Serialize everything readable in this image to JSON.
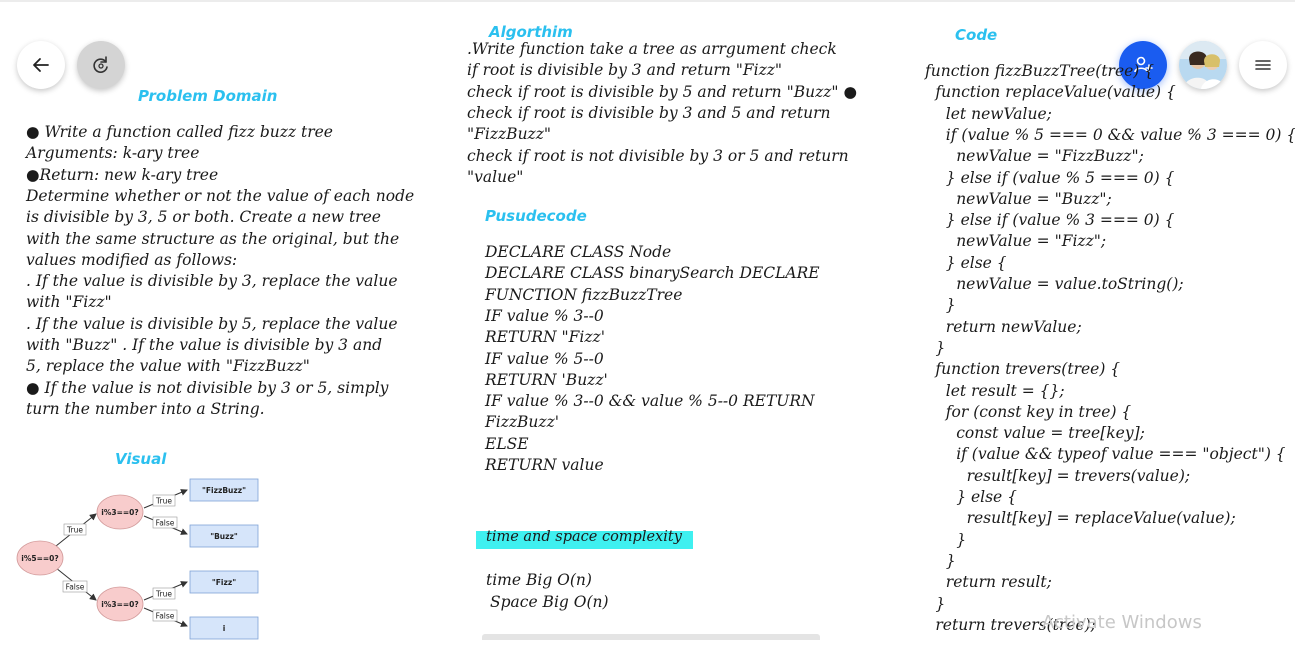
{
  "toolbar": {
    "back_icon": "arrow-left-icon",
    "redo_icon": "rotate-redo-icon",
    "share_icon": "add-user-icon",
    "menu_icon": "hamburger-menu-icon",
    "accent_color": "#1a5cf0"
  },
  "problem_domain": {
    "heading": "Problem Domain",
    "lines": [
      "● Write a function called fizz buzz tree",
      "Arguments: k-ary tree",
      "●Return: new k-ary tree",
      "Determine whether or not the value of each node",
      "is divisible by 3, 5 or both. Create a new tree",
      "with the same structure as the original, but the",
      "values modified as follows:",
      ". If the value is divisible by 3, replace the value",
      "with \"Fizz\"",
      ". If the value is divisible by 5, replace the value",
      "with \"Buzz\" . If the value is divisible by 3 and",
      "5, replace the value with \"FizzBuzz\"",
      "● If the value is not divisible by 3 or 5, simply",
      "turn the number into a String."
    ]
  },
  "visual": {
    "heading": "Visual",
    "nodes": {
      "root": "i%5==0?",
      "upper": "i%3==0?",
      "lower": "i%3==0?"
    },
    "edge_labels": {
      "root_true": "True",
      "root_false": "False",
      "upper_true": "True",
      "upper_false": "False",
      "lower_true": "True",
      "lower_false": "False"
    },
    "leaves": [
      "\"FizzBuzz\"",
      "\"Buzz\"",
      "\"Fizz\"",
      "i"
    ]
  },
  "algorithm": {
    "heading": "Algorthim",
    "lines": [
      ".Write function take a tree as arrgument check",
      "if root is divisible by 3 and return \"Fizz\"",
      "check if root is divisible by 5 and return \"Buzz\" ●",
      "check if root is divisible by 3 and 5 and return",
      "\"FizzBuzz\"",
      "check if root is not divisible by 3 or 5 and return",
      "\"value\""
    ]
  },
  "pseudocode": {
    "heading": "Pusudecode",
    "lines": [
      "DECLARE CLASS Node",
      "DECLARE CLASS binarySearch DECLARE",
      "FUNCTION fizzBuzzTree",
      "IF value % 3--0",
      "RETURN \"Fizz'",
      "IF value % 5--0",
      "RETURN 'Buzz'",
      "IF value % 3--0 && value % 5--0 RETURN",
      "FizzBuzz'",
      "ELSE",
      "RETURN value"
    ]
  },
  "complexity": {
    "heading": "time and space complexity",
    "highlight_color": "#3ff0f0",
    "time": "time Big O(n)",
    "space": "Space Big O(n)"
  },
  "code": {
    "heading": "Code",
    "lines": [
      "function fizzBuzzTree(tree) {",
      "  function replaceValue(value) {",
      "    let newValue;",
      "    if (value % 5 === 0 && value % 3 === 0) {",
      "      newValue = \"FizzBuzz\";",
      "    } else if (value % 5 === 0) {",
      "      newValue = \"Buzz\";",
      "    } else if (value % 3 === 0) {",
      "      newValue = \"Fizz\";",
      "    } else {",
      "      newValue = value.toString();",
      "    }",
      "    return newValue;",
      "  }",
      "  function trevers(tree) {",
      "    let result = {};",
      "    for (const key in tree) {",
      "      const value = tree[key];",
      "      if (value && typeof value === \"object\") {",
      "        result[key] = trevers(value);",
      "      } else {",
      "        result[key] = replaceValue(value);",
      "      }",
      "    }",
      "    return result;",
      "  }",
      "  return trevers(tree);"
    ]
  },
  "watermark": "Activate Windows"
}
